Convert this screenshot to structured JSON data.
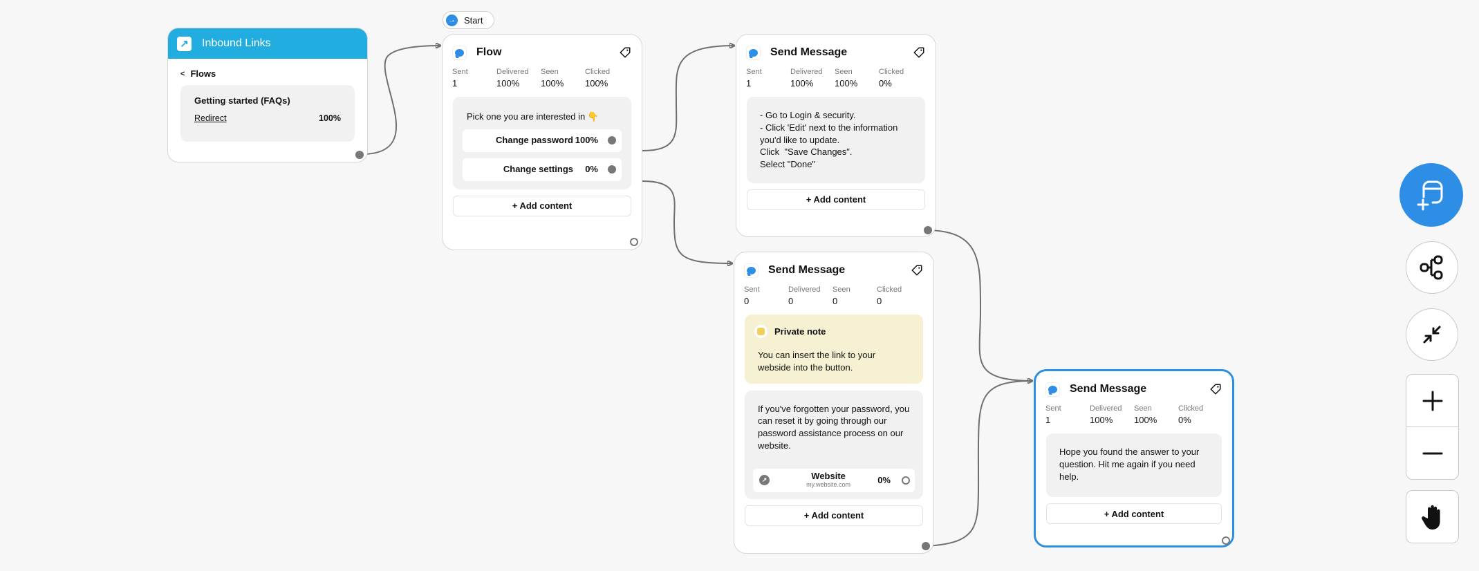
{
  "start": {
    "label": "Start",
    "icon": "arrow-right-circle-icon"
  },
  "inbound": {
    "title": "Inbound Links",
    "icon": "external-link-icon",
    "section_label": "Flows",
    "section_icon": "share-icon",
    "flow_name": "Getting started (FAQs)",
    "link_label": "Redirect",
    "link_pct": "100%"
  },
  "stat_labels": {
    "sent": "Sent",
    "delivered": "Delivered",
    "seen": "Seen",
    "clicked": "Clicked"
  },
  "add_content_label": "+ Add content",
  "flow": {
    "title": "Flow",
    "stats": {
      "sent": "1",
      "delivered": "100%",
      "seen": "100%",
      "clicked": "100%"
    },
    "question": "Pick one you are interested in 👇",
    "choices": [
      {
        "label": "Change password",
        "pct": "100%"
      },
      {
        "label": "Change settings",
        "pct": "0%"
      }
    ]
  },
  "send_message_1": {
    "title": "Send Message",
    "stats": {
      "sent": "1",
      "delivered": "100%",
      "seen": "100%",
      "clicked": "0%"
    },
    "text_lines": [
      "- Go to Login & security.",
      "- Click 'Edit' next to the information you'd like to update.",
      "Click  \"Save Changes\".",
      "Select \"Done\""
    ]
  },
  "send_message_2": {
    "title": "Send Message",
    "stats": {
      "sent": "0",
      "delivered": "0",
      "seen": "0",
      "clicked": "0"
    },
    "note": {
      "title": "Private note",
      "text": "You can insert the link to your webside into the button."
    },
    "text": "If you've forgotten your password, you can reset it by going through our password assistance process on our website.",
    "button": {
      "label": "Website",
      "url": "my.website.com",
      "pct": "0%"
    }
  },
  "send_message_3": {
    "title": "Send Message",
    "stats": {
      "sent": "1",
      "delivered": "100%",
      "seen": "100%",
      "clicked": "0%"
    },
    "text": "Hope you found the answer to your question. Hit me again if you need help.",
    "selected": true
  },
  "controls": {
    "add_node": "add-node-icon",
    "auto_layout": "flowchart-icon",
    "collapse": "collapse-icon",
    "zoom_in": "plus-icon",
    "zoom_out": "minus-icon",
    "pan": "hand-icon"
  },
  "colors": {
    "accent": "#2e8ee6",
    "inbound_header": "#21ade0",
    "note_bg": "#f5f1d2",
    "edge": "#6f6f6f",
    "selected_border": "#2d8fe0"
  }
}
